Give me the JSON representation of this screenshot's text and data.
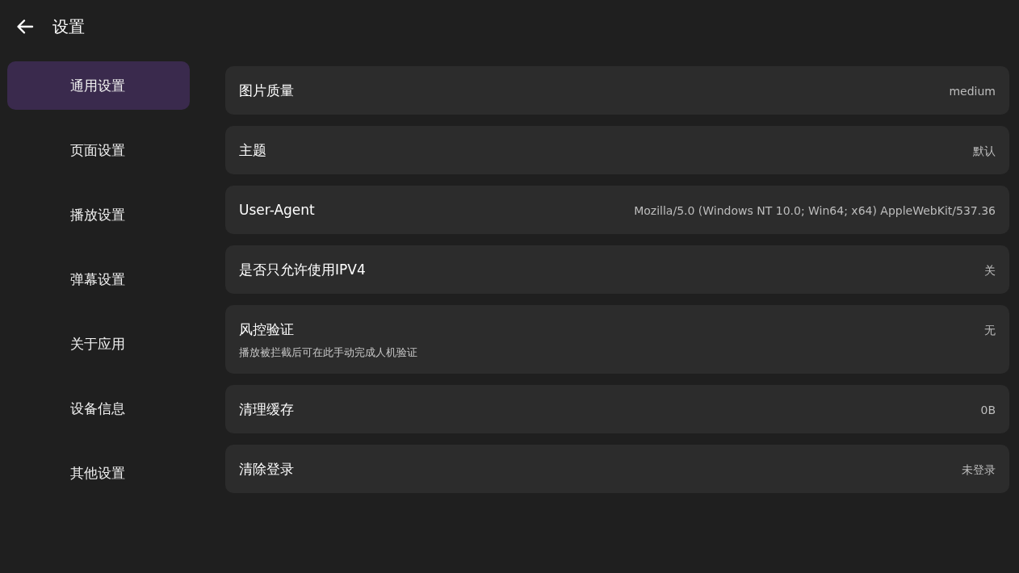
{
  "header": {
    "title": "设置"
  },
  "sidebar": {
    "items": [
      {
        "label": "通用设置",
        "selected": true
      },
      {
        "label": "页面设置",
        "selected": false
      },
      {
        "label": "播放设置",
        "selected": false
      },
      {
        "label": "弹幕设置",
        "selected": false
      },
      {
        "label": "关于应用",
        "selected": false
      },
      {
        "label": "设备信息",
        "selected": false
      },
      {
        "label": "其他设置",
        "selected": false
      }
    ]
  },
  "settings": [
    {
      "label": "图片质量",
      "value": "medium"
    },
    {
      "label": "主题",
      "value": "默认"
    },
    {
      "label": "User-Agent",
      "value": "Mozilla/5.0 (Windows NT 10.0; Win64; x64) AppleWebKit/537.36"
    },
    {
      "label": "是否只允许使用IPV4",
      "value": "关"
    },
    {
      "label": "风控验证",
      "value": "无",
      "description": "播放被拦截后可在此手动完成人机验证"
    },
    {
      "label": "清理缓存",
      "value": "0B"
    },
    {
      "label": "清除登录",
      "value": "未登录"
    }
  ]
}
